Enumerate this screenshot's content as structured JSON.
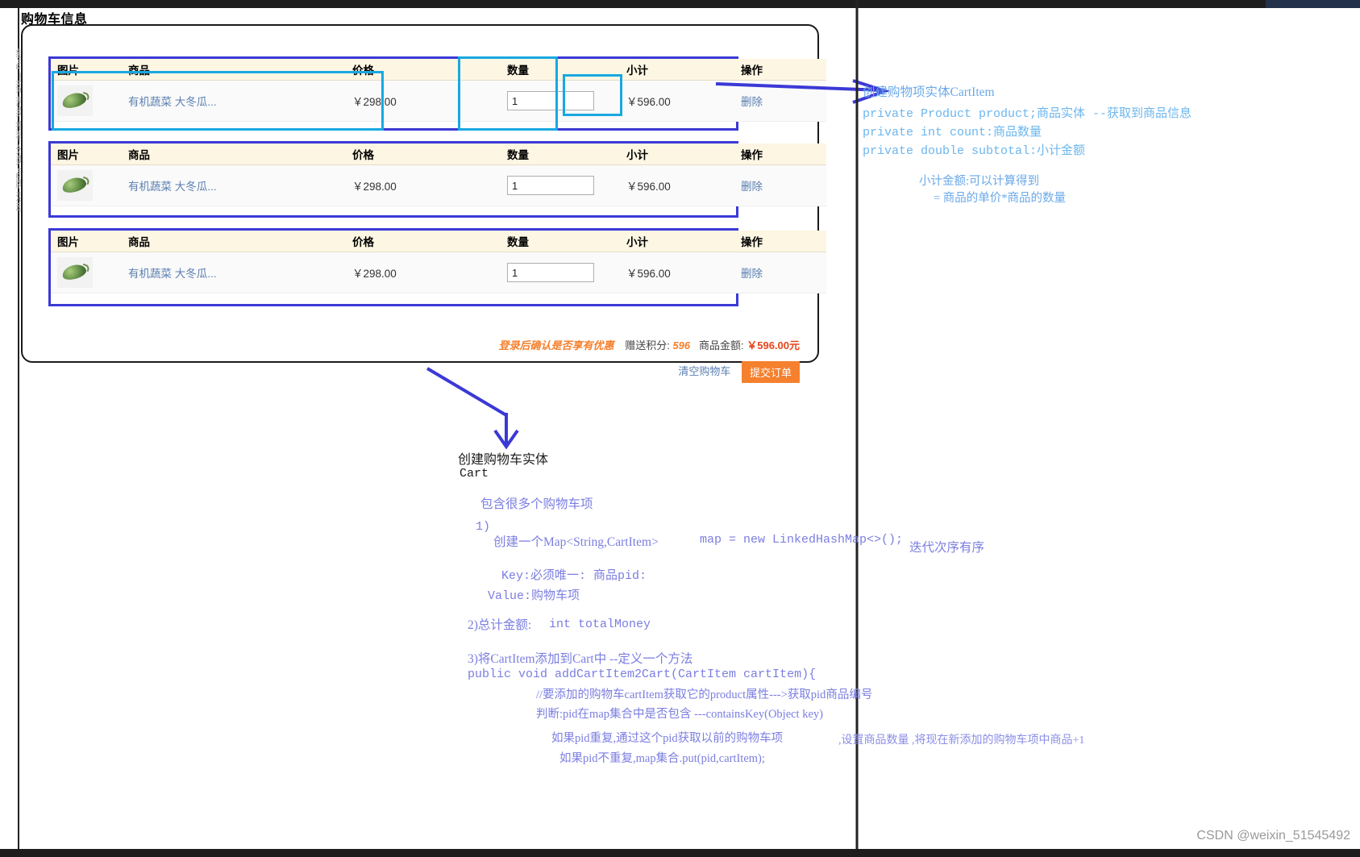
{
  "page": {
    "title": "购物车信息",
    "watermark": "CSDN @weixin_51545492"
  },
  "left_rail_ghost": "新品 上架 热卖 推荐 分类 品牌 活动",
  "cart": {
    "columns": [
      "图片",
      "商品",
      "价格",
      "数量",
      "小计",
      "操作"
    ],
    "rows": [
      {
        "image_alt": "冬瓜缩略图",
        "name": "有机蔬菜 大冬瓜...",
        "price": "￥298.00",
        "qty": "1",
        "subtotal": "￥596.00",
        "action": "删除"
      },
      {
        "image_alt": "冬瓜缩略图",
        "name": "有机蔬菜 大冬瓜...",
        "price": "￥298.00",
        "qty": "1",
        "subtotal": "￥596.00",
        "action": "删除"
      },
      {
        "image_alt": "冬瓜缩略图",
        "name": "有机蔬菜 大冬瓜...",
        "price": "￥298.00",
        "qty": "1",
        "subtotal": "￥596.00",
        "action": "删除"
      }
    ],
    "summary": {
      "promo": "登录后确认是否享有优惠",
      "points_label": "赠送积分:",
      "points_value": "596",
      "amount_label": "商品金额:",
      "amount_value": "￥596.00元"
    },
    "actions": {
      "clear": "清空购物车",
      "submit": "提交订单"
    }
  },
  "annotations": {
    "cart_item": {
      "title": "创建购物项实体CartItem",
      "fields": [
        "private Product product;商品实体 --获取到商品信息",
        "private int count:商品数量",
        "private double subtotal:小计金额"
      ],
      "note_line1": "小计金额:可以计算得到",
      "note_line2": "= 商品的单价*商品的数量"
    },
    "cart_entity": {
      "title": "创建购物车实体",
      "class_name": "Cart",
      "desc": "包含很多个购物车项",
      "step1_num": "1)",
      "step1_cn": "创建一个Map<String,CartItem>",
      "step1_code": "map = new LinkedHashMap<>();",
      "step1_side": "迭代次序有序",
      "key_line": "Key:必须唯一:  商品pid:",
      "value_line": "Value:购物车项",
      "step2_cn": "2)总计金额:",
      "step2_code": "int totalMoney",
      "step3_cn": "3)将CartItem添加到Cart中 --定义一个方法",
      "step3_sig": "public void addCartItem2Cart(CartItem cartItem){",
      "step3_comment": "//要添加的购物车cartItem获取它的product属性--->获取pid商品编号",
      "step3_judge": "判断:pid在map集合中是否包含   ---containsKey(Object key)",
      "step3_dup": "如果pid重复,通过这个pid获取以前的购物车项",
      "step3_dup2": ",设置商品数量 ,将现在新添加的购物车项中商品+1",
      "step3_nodup": "如果pid不重复,map集合.put(pid,cartItem);"
    }
  },
  "colors": {
    "accent_orange": "#f5802e",
    "money_red": "#e8461d",
    "link_blue": "#5a7fb0",
    "anno_blue": "#6cb6ee",
    "anno_purple": "#7b7ee0",
    "highlight_cyan": "#19a8e0",
    "block_border": "#3b39d6"
  }
}
